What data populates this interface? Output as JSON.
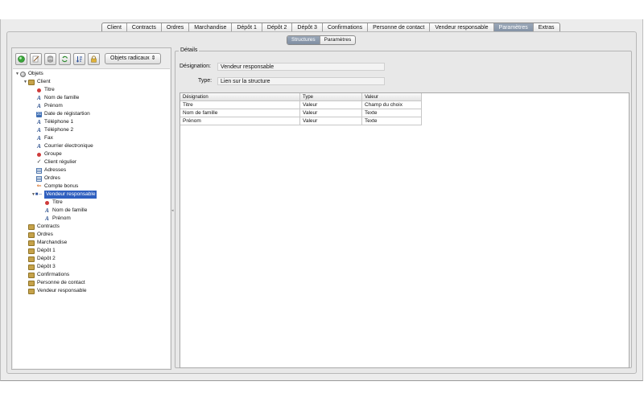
{
  "main_tabs": [
    {
      "label": "Client",
      "active": false
    },
    {
      "label": "Contracts",
      "active": false
    },
    {
      "label": "Ordres",
      "active": false
    },
    {
      "label": "Marchandise",
      "active": false
    },
    {
      "label": "Dépôt 1",
      "active": false
    },
    {
      "label": "Dépôt 2",
      "active": false
    },
    {
      "label": "Dépôt 3",
      "active": false
    },
    {
      "label": "Confirmations",
      "active": false
    },
    {
      "label": "Personne de contact",
      "active": false
    },
    {
      "label": "Vendeur responsable",
      "active": false
    },
    {
      "label": "Paramètres",
      "active": true
    },
    {
      "label": "Extras",
      "active": false
    }
  ],
  "sub_tabs": [
    {
      "label": "Structures",
      "active": true
    },
    {
      "label": "Paramètres",
      "active": false
    }
  ],
  "toolbar": {
    "icons": [
      "add-green-icon",
      "edit-document-icon",
      "database-icon",
      "refresh-icon",
      "sort-icon",
      "lock-icon"
    ],
    "select_value": "Objets radicaux"
  },
  "tree": [
    {
      "label": "Objets",
      "level": 0,
      "icon": "globe",
      "expanded": true
    },
    {
      "label": "Client",
      "level": 1,
      "icon": "folder",
      "expanded": true
    },
    {
      "label": "Titre",
      "level": 2,
      "icon": "dot"
    },
    {
      "label": "Nom de famille",
      "level": 2,
      "icon": "text"
    },
    {
      "label": "Prénom",
      "level": 2,
      "icon": "text"
    },
    {
      "label": "Date de régistartion",
      "level": 2,
      "icon": "cal"
    },
    {
      "label": "Téléphone 1",
      "level": 2,
      "icon": "text"
    },
    {
      "label": "Téléphone 2",
      "level": 2,
      "icon": "text"
    },
    {
      "label": "Fax",
      "level": 2,
      "icon": "text"
    },
    {
      "label": "Courrier électronique",
      "level": 2,
      "icon": "text"
    },
    {
      "label": "Groupe",
      "level": 2,
      "icon": "dot"
    },
    {
      "label": "Client régulier",
      "level": 2,
      "icon": "check"
    },
    {
      "label": "Adresses",
      "level": 2,
      "icon": "list"
    },
    {
      "label": "Ordres",
      "level": 2,
      "icon": "list"
    },
    {
      "label": "Compte bonus",
      "level": 2,
      "icon": "bonus"
    },
    {
      "label": "Vendeur responsable",
      "level": 2,
      "icon": "link",
      "expanded": true,
      "selected": true
    },
    {
      "label": "Titre",
      "level": 3,
      "icon": "dot"
    },
    {
      "label": "Nom de famille",
      "level": 3,
      "icon": "text"
    },
    {
      "label": "Prénom",
      "level": 3,
      "icon": "text"
    },
    {
      "label": "Contracts",
      "level": 1,
      "icon": "folder"
    },
    {
      "label": "Ordres",
      "level": 1,
      "icon": "folder"
    },
    {
      "label": "Marchandise",
      "level": 1,
      "icon": "folder"
    },
    {
      "label": "Dépôt 1",
      "level": 1,
      "icon": "folder"
    },
    {
      "label": "Dépôt 2",
      "level": 1,
      "icon": "folder"
    },
    {
      "label": "Dépôt 3",
      "level": 1,
      "icon": "folder"
    },
    {
      "label": "Confirmations",
      "level": 1,
      "icon": "folder"
    },
    {
      "label": "Personne de contact",
      "level": 1,
      "icon": "folder"
    },
    {
      "label": "Vendeur responsable",
      "level": 1,
      "icon": "folder"
    }
  ],
  "details": {
    "legend": "Détails",
    "designation_label": "Désignation:",
    "designation_value": "Vendeur responsable",
    "type_label": "Type:",
    "type_value": "Lien sur la structure"
  },
  "table": {
    "headers": [
      "Désignation",
      "Type",
      "Valeur"
    ],
    "rows": [
      [
        "Titre",
        "Valeur",
        "Champ du choix"
      ],
      [
        "Nom de famille",
        "Valeur",
        "Texte"
      ],
      [
        "Prénom",
        "Valeur",
        "Texte"
      ]
    ]
  }
}
